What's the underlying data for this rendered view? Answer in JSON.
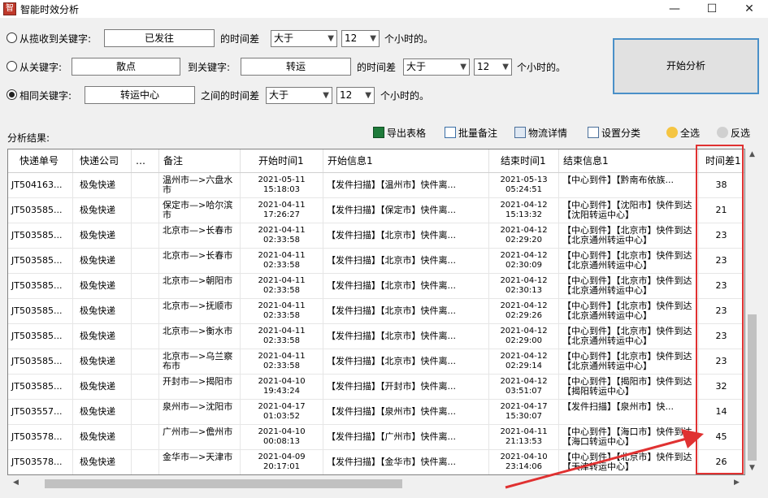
{
  "window": {
    "title": "智能时效分析",
    "controls": {
      "minimize": "—",
      "maximize": "☐",
      "close": "✕"
    }
  },
  "options": {
    "row1": {
      "label": "从揽收到关键字:",
      "keyword": "已发往",
      "suffix": "的时间差",
      "compare": "大于",
      "hours": "12",
      "unit": "个小时的。",
      "selected": false
    },
    "row2": {
      "label": "从关键字:",
      "from_keyword": "散点",
      "mid": "到关键字:",
      "to_keyword": "转运",
      "suffix": "的时间差",
      "compare": "大于",
      "hours": "12",
      "unit": "个小时的。",
      "selected": false
    },
    "row3": {
      "label": "相同关键字:",
      "keyword": "转运中心",
      "suffix": "之间的时间差",
      "compare": "大于",
      "hours": "12",
      "unit": "个小时的。",
      "selected": true
    }
  },
  "start_button": "开始分析",
  "results_label": "分析结果:",
  "toolbar": {
    "export": "导出表格",
    "batch_note": "批量备注",
    "logistics_detail": "物流详情",
    "set_category": "设置分类",
    "select_all": "全选",
    "invert": "反选"
  },
  "table": {
    "columns": [
      "快递单号",
      "快递公司",
      "…",
      "备注",
      "开始时间1",
      "开始信息1",
      "结束时间1",
      "结束信息1",
      "时间差1"
    ],
    "rows": [
      {
        "no": "JT504163...",
        "company": "极兔快递",
        "note": "温州市—>六盘水市",
        "start_time": [
          "2021-05-11",
          "15:18:03"
        ],
        "start_info": "【发件扫描】【温州市】快件离...",
        "end_time": [
          "2021-05-13",
          "05:24:51"
        ],
        "end_info": "【中心到件】【黔南布依族...",
        "diff": "38"
      },
      {
        "no": "JT503585...",
        "company": "极兔快递",
        "note": "保定市—>哈尔滨市",
        "start_time": [
          "2021-04-11",
          "17:26:27"
        ],
        "start_info": "【发件扫描】【保定市】快件离...",
        "end_time": [
          "2021-04-12",
          "15:13:32"
        ],
        "end_info": "【中心到件】【沈阳市】快件到达【沈阳转运中心】",
        "diff": "21"
      },
      {
        "no": "JT503585...",
        "company": "极兔快递",
        "note": "北京市—>长春市",
        "start_time": [
          "2021-04-11",
          "02:33:58"
        ],
        "start_info": "【发件扫描】【北京市】快件离...",
        "end_time": [
          "2021-04-12",
          "02:29:20"
        ],
        "end_info": "【中心到件】【北京市】快件到达【北京通州转运中心】",
        "diff": "23"
      },
      {
        "no": "JT503585...",
        "company": "极兔快递",
        "note": "北京市—>长春市",
        "start_time": [
          "2021-04-11",
          "02:33:58"
        ],
        "start_info": "【发件扫描】【北京市】快件离...",
        "end_time": [
          "2021-04-12",
          "02:30:09"
        ],
        "end_info": "【中心到件】【北京市】快件到达【北京通州转运中心】",
        "diff": "23"
      },
      {
        "no": "JT503585...",
        "company": "极兔快递",
        "note": "北京市—>朝阳市",
        "start_time": [
          "2021-04-11",
          "02:33:58"
        ],
        "start_info": "【发件扫描】【北京市】快件离...",
        "end_time": [
          "2021-04-12",
          "02:30:13"
        ],
        "end_info": "【中心到件】【北京市】快件到达【北京通州转运中心】",
        "diff": "23"
      },
      {
        "no": "JT503585...",
        "company": "极兔快递",
        "note": "北京市—>抚顺市",
        "start_time": [
          "2021-04-11",
          "02:33:58"
        ],
        "start_info": "【发件扫描】【北京市】快件离...",
        "end_time": [
          "2021-04-12",
          "02:29:26"
        ],
        "end_info": "【中心到件】【北京市】快件到达【北京通州转运中心】",
        "diff": "23"
      },
      {
        "no": "JT503585...",
        "company": "极兔快递",
        "note": "北京市—>衡水市",
        "start_time": [
          "2021-04-11",
          "02:33:58"
        ],
        "start_info": "【发件扫描】【北京市】快件离...",
        "end_time": [
          "2021-04-12",
          "02:29:00"
        ],
        "end_info": "【中心到件】【北京市】快件到达【北京通州转运中心】",
        "diff": "23"
      },
      {
        "no": "JT503585...",
        "company": "极兔快递",
        "note": "北京市—>乌兰察布市",
        "start_time": [
          "2021-04-11",
          "02:33:58"
        ],
        "start_info": "【发件扫描】【北京市】快件离...",
        "end_time": [
          "2021-04-12",
          "02:29:14"
        ],
        "end_info": "【中心到件】【北京市】快件到达【北京通州转运中心】",
        "diff": "23"
      },
      {
        "no": "JT503585...",
        "company": "极兔快递",
        "note": "开封市—>揭阳市",
        "start_time": [
          "2021-04-10",
          "19:43:24"
        ],
        "start_info": "【发件扫描】【开封市】快件离...",
        "end_time": [
          "2021-04-12",
          "03:51:07"
        ],
        "end_info": "【中心到件】【揭阳市】快件到达【揭阳转运中心】",
        "diff": "32"
      },
      {
        "no": "JT503557...",
        "company": "极兔快递",
        "note": "泉州市—>沈阳市",
        "start_time": [
          "2021-04-17",
          "01:03:52"
        ],
        "start_info": "【发件扫描】【泉州市】快件离...",
        "end_time": [
          "2021-04-17",
          "15:30:07"
        ],
        "end_info": "【发件扫描】【泉州市】快...",
        "diff": "14"
      },
      {
        "no": "JT503578...",
        "company": "极兔快递",
        "note": "广州市—>儋州市",
        "start_time": [
          "2021-04-10",
          "00:08:13"
        ],
        "start_info": "【发件扫描】【广州市】快件离...",
        "end_time": [
          "2021-04-11",
          "21:13:53"
        ],
        "end_info": "【中心到件】【海口市】快件到达【海口转运中心】",
        "diff": "45"
      },
      {
        "no": "JT503578...",
        "company": "极兔快递",
        "note": "金华市—>天津市",
        "start_time": [
          "2021-04-09",
          "20:17:01"
        ],
        "start_info": "【发件扫描】【金华市】快件离...",
        "end_time": [
          "2021-04-10",
          "23:14:06"
        ],
        "end_info": "【中心到件】【北京市】快件到达【天津转运中心】",
        "diff": "26"
      }
    ]
  },
  "colors": {
    "highlight": "#e03131",
    "accent_border": "#4a90c8"
  }
}
